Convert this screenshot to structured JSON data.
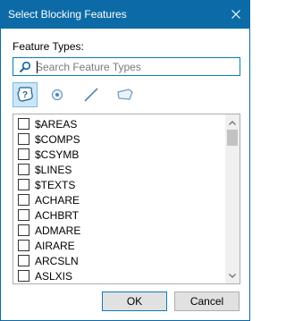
{
  "window": {
    "title": "Select Blocking Features"
  },
  "feature_types": {
    "label": "Feature Types:",
    "search_placeholder": "Search Feature Types",
    "search_value": ""
  },
  "toolbar": {
    "buttons": [
      {
        "icon": "all-features-icon",
        "active": true
      },
      {
        "icon": "point-feature-icon",
        "active": false
      },
      {
        "icon": "line-feature-icon",
        "active": false
      },
      {
        "icon": "area-feature-icon",
        "active": false
      }
    ]
  },
  "list": {
    "items": [
      {
        "label": "$AREAS",
        "checked": false
      },
      {
        "label": "$COMPS",
        "checked": false
      },
      {
        "label": "$CSYMB",
        "checked": false
      },
      {
        "label": "$LINES",
        "checked": false
      },
      {
        "label": "$TEXTS",
        "checked": false
      },
      {
        "label": "ACHARE",
        "checked": false
      },
      {
        "label": "ACHBRT",
        "checked": false
      },
      {
        "label": "ADMARE",
        "checked": false
      },
      {
        "label": "AIRARE",
        "checked": false
      },
      {
        "label": "ARCSLN",
        "checked": false
      },
      {
        "label": "ASLXIS",
        "checked": false
      }
    ]
  },
  "buttons": {
    "ok_label": "OK",
    "cancel_label": "Cancel"
  },
  "colors": {
    "titlebar": "#0c6ba7",
    "accent": "#0f7ab8",
    "toolbar_active": "#cce6f8"
  }
}
